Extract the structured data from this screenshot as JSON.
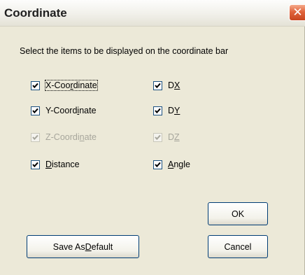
{
  "window": {
    "title": "Coordinate",
    "close_glyph": "✕",
    "close_icon": "close-icon"
  },
  "instructions": "Select the items to be displayed on the coordinate bar",
  "options": {
    "x_coord": {
      "label_pre": "X-Coo",
      "label_mnemonic": "r",
      "label_post": "dinate",
      "checked": true,
      "enabled": true
    },
    "dx": {
      "label_pre": "D",
      "label_mnemonic": "X",
      "label_post": "",
      "checked": true,
      "enabled": true
    },
    "y_coord": {
      "label_pre": "Y-Coord",
      "label_mnemonic": "i",
      "label_post": "nate",
      "checked": true,
      "enabled": true
    },
    "dy": {
      "label_pre": "D",
      "label_mnemonic": "Y",
      "label_post": "",
      "checked": true,
      "enabled": true
    },
    "z_coord": {
      "label_pre": "Z-Coordi",
      "label_mnemonic": "n",
      "label_post": "ate",
      "checked": true,
      "enabled": false
    },
    "dz": {
      "label_pre": "D",
      "label_mnemonic": "Z",
      "label_post": "",
      "checked": true,
      "enabled": false
    },
    "distance": {
      "label_pre": "",
      "label_mnemonic": "D",
      "label_post": "istance",
      "checked": true,
      "enabled": true
    },
    "angle": {
      "label_pre": "",
      "label_mnemonic": "A",
      "label_post": "ngle",
      "checked": true,
      "enabled": true
    }
  },
  "buttons": {
    "ok": "OK",
    "save_default_pre": "Save As ",
    "save_default_mnemonic": "D",
    "save_default_post": "efault",
    "cancel": "Cancel"
  },
  "colors": {
    "checkbox_border": "#1c5180",
    "button_border": "#003c74",
    "close_button": "#e0643c"
  }
}
